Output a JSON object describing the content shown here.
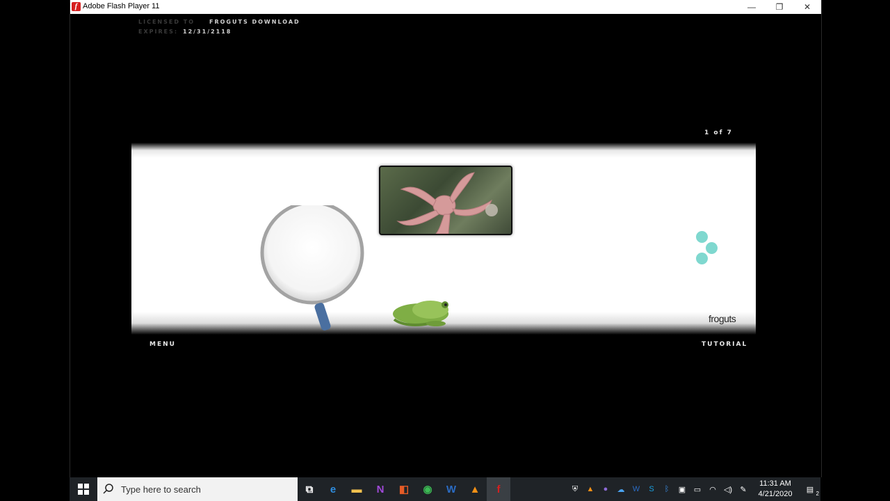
{
  "window": {
    "title": "Adobe Flash Player 11",
    "minimize_glyph": "—",
    "maximize_glyph": "❐",
    "close_glyph": "✕"
  },
  "license": {
    "licensed_label": "Licensed to",
    "licensed_value": "Froguts Download",
    "expires_label": "Expires:",
    "expires_value": "12/31/2118"
  },
  "stage": {
    "page_counter": "1 of 7",
    "menu_label": "Menu",
    "tutorial_label": "Tutorial",
    "logo_text": "froguts"
  },
  "taskbar": {
    "search_placeholder": "Type here to search",
    "time": "11:31 AM",
    "date": "4/21/2020",
    "notification_count": "2",
    "icons": [
      "task-view-icon",
      "edge-icon",
      "file-explorer-icon",
      "onenote-icon",
      "office-icon",
      "chrome-icon",
      "word-icon",
      "vlc-icon",
      "flash-icon"
    ],
    "tray_icons": [
      "defender-icon",
      "vlc-tray-icon",
      "teams-icon",
      "onedrive-icon",
      "word-tray-icon",
      "skype-icon",
      "bluetooth-icon",
      "display-icon",
      "battery-icon",
      "network-icon",
      "volume-icon",
      "pen-icon"
    ]
  },
  "colors": {
    "flash_red": "#d61f1f",
    "dot_teal": "#7fd8cf",
    "taskbar_bg": "#1f2327"
  }
}
